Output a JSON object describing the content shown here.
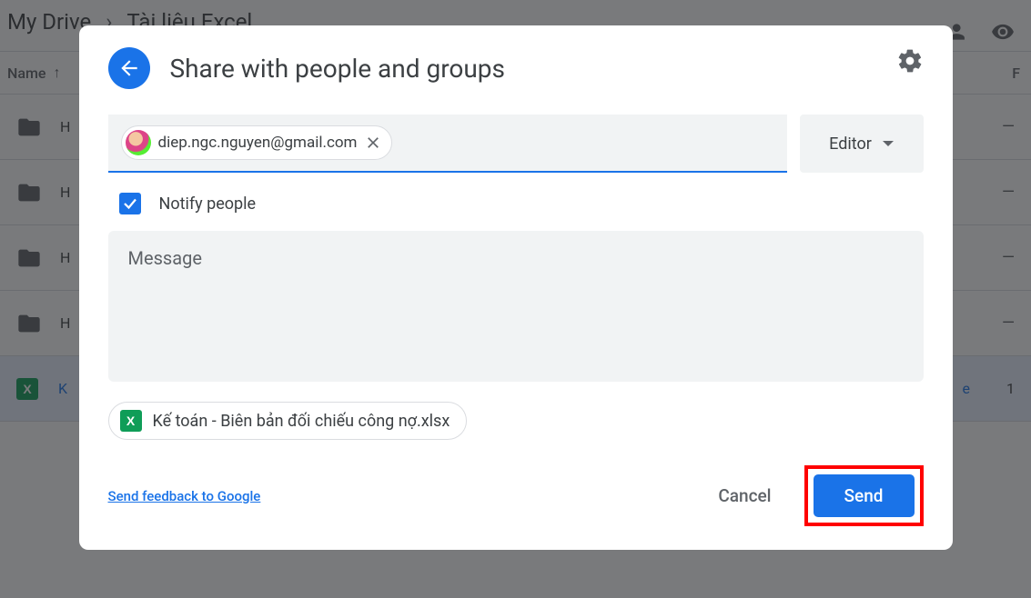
{
  "breadcrumb": {
    "root": "My Drive",
    "current": "Tài liệu Excel"
  },
  "table": {
    "header_name": "Name",
    "header_right": "F",
    "rows": [
      {
        "label": "H",
        "type": "folder",
        "right": "—"
      },
      {
        "label": "H",
        "type": "folder",
        "right": "—"
      },
      {
        "label": "H",
        "type": "folder",
        "right": "—"
      },
      {
        "label": "H",
        "type": "folder",
        "right": "—"
      },
      {
        "label": "K",
        "type": "sheet",
        "right": "1"
      }
    ]
  },
  "dialog": {
    "title": "Share with people and groups",
    "chip_email": "diep.ngc.nguyen@gmail.com",
    "role": "Editor",
    "notify_label": "Notify people",
    "notify_checked": true,
    "message_placeholder": "Message",
    "file_name": "Kế toán - Biên bản đối chiếu công nợ.xlsx",
    "feedback": "Send feedback to Google",
    "cancel": "Cancel",
    "send": "Send"
  }
}
